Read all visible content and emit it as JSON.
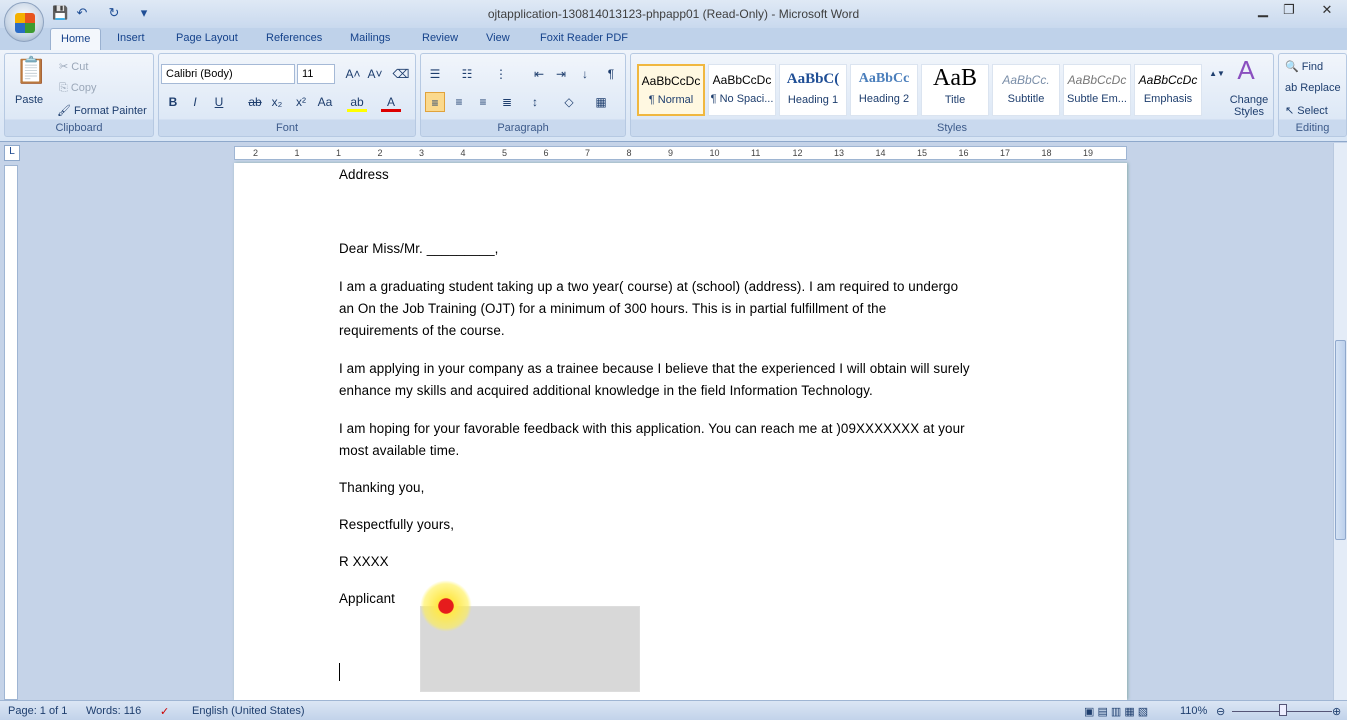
{
  "window": {
    "title": "ojtapplication-130814013123-phpapp01 (Read-Only) - Microsoft Word"
  },
  "tabs": [
    "Home",
    "Insert",
    "Page Layout",
    "References",
    "Mailings",
    "Review",
    "View",
    "Foxit Reader PDF"
  ],
  "clipboard": {
    "paste": "Paste",
    "cut": "Cut",
    "copy": "Copy",
    "format_painter": "Format Painter",
    "label": "Clipboard"
  },
  "font": {
    "name": "Calibri (Body)",
    "size": "11",
    "label": "Font"
  },
  "paragraph": {
    "label": "Paragraph"
  },
  "styles": {
    "items": [
      {
        "preview": "AaBbCcDc",
        "name": "¶ Normal"
      },
      {
        "preview": "AaBbCcDc",
        "name": "¶ No Spaci..."
      },
      {
        "preview": "AaBbC(",
        "name": "Heading 1"
      },
      {
        "preview": "AaBbCc",
        "name": "Heading 2"
      },
      {
        "preview": "AaB",
        "name": "Title"
      },
      {
        "preview": "AaBbCc.",
        "name": "Subtitle"
      },
      {
        "preview": "AaBbCcDc",
        "name": "Subtle Em..."
      },
      {
        "preview": "AaBbCcDc",
        "name": "Emphasis"
      }
    ],
    "change_styles": "Change Styles",
    "label": "Styles"
  },
  "editing": {
    "find": "Find",
    "replace": "Replace",
    "select": "Select",
    "label": "Editing"
  },
  "ruler": [
    "2",
    "1",
    "1",
    "2",
    "3",
    "4",
    "5",
    "6",
    "7",
    "8",
    "9",
    "10",
    "11",
    "12",
    "13",
    "14",
    "15",
    "16",
    "17",
    "18",
    "19"
  ],
  "document": {
    "lines": [
      "Address",
      "Dear Miss/Mr.    _________,",
      "I am a graduating student  taking up a two year( course) at (school) (address). I am required to undergo",
      "an On the Job Training (OJT) for a minimum of 300 hours.  This is in partial fulfillment of the",
      "requirements of the course.",
      "I am applying in your company as a trainee because I believe that the experienced I will obtain will surely",
      "enhance my skills and acquired additional knowledge in the field Information Technology.",
      "I am hoping for your favorable feedback with this application. You can reach me at )09XXXXXXX  at your",
      "most available time.",
      "Thanking you,",
      "Respectfully yours,",
      "R XXXX",
      "Applicant"
    ]
  },
  "status": {
    "page": "Page: 1 of 1",
    "words": "Words: 116",
    "language": "English (United States)",
    "zoom": "110%"
  }
}
